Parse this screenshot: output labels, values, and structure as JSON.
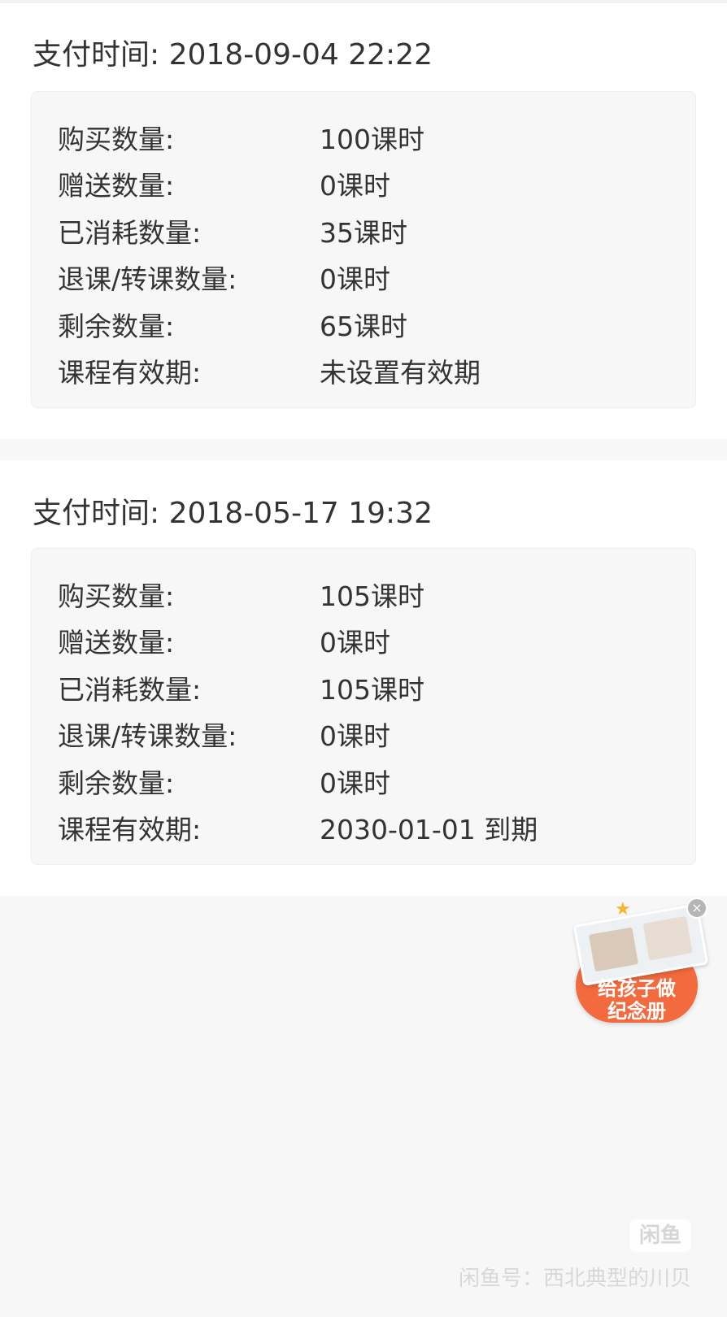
{
  "records": [
    {
      "pay_time": "支付时间: 2018-09-04 22:22",
      "rows": [
        {
          "label": "购买数量:",
          "value": "100课时"
        },
        {
          "label": "赠送数量:",
          "value": "0课时"
        },
        {
          "label": "已消耗数量:",
          "value": "35课时"
        },
        {
          "label": "退课/转课数量:",
          "value": "0课时"
        },
        {
          "label": "剩余数量:",
          "value": "65课时"
        },
        {
          "label": "课程有效期:",
          "value": "未设置有效期"
        }
      ]
    },
    {
      "pay_time": "支付时间: 2018-05-17 19:32",
      "rows": [
        {
          "label": "购买数量:",
          "value": "105课时"
        },
        {
          "label": "赠送数量:",
          "value": "0课时"
        },
        {
          "label": "已消耗数量:",
          "value": "105课时"
        },
        {
          "label": "退课/转课数量:",
          "value": "0课时"
        },
        {
          "label": "剩余数量:",
          "value": "0课时"
        },
        {
          "label": "课程有效期:",
          "value": "2030-01-01 到期"
        }
      ]
    }
  ],
  "ad": {
    "text": "给孩子做\n纪念册",
    "close_symbol": "×",
    "icon": "photo-album-icon",
    "brand_color": "#f26a3d"
  },
  "watermark": {
    "logo_text": "闲鱼",
    "text": "闲鱼号：西北典型的川贝"
  }
}
